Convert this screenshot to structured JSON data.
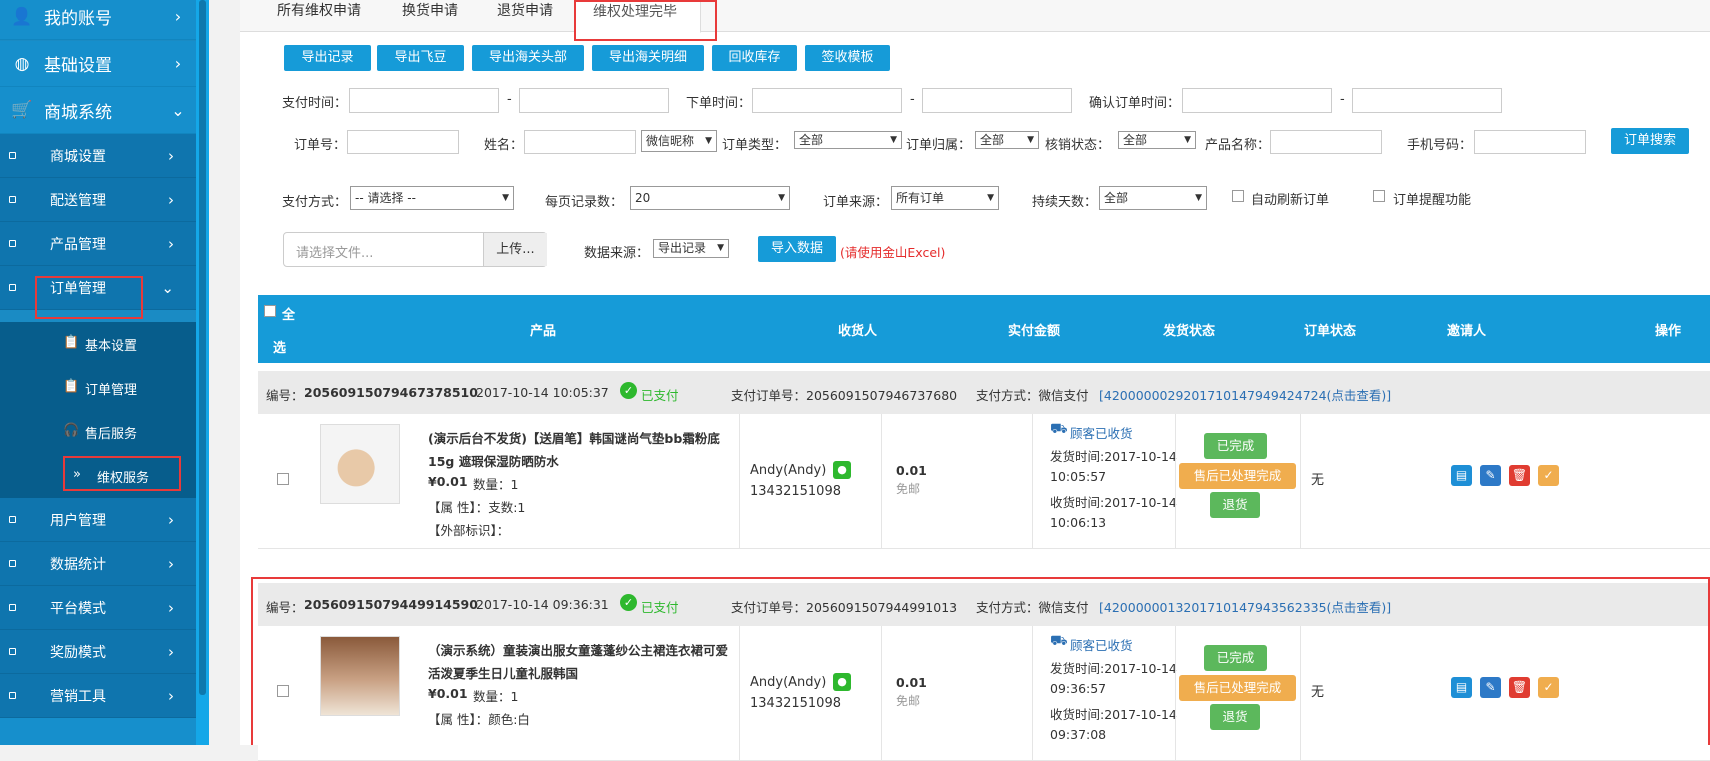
{
  "sidebar": {
    "top_items": [
      {
        "label": "我的账号",
        "icon": "user-icon"
      },
      {
        "label": "基础设置",
        "icon": "globe-icon"
      },
      {
        "label": "商城系统",
        "icon": "cart-icon"
      }
    ],
    "sub_items": [
      "商城设置",
      "配送管理",
      "产品管理",
      "订单管理"
    ],
    "leaf_items": [
      "基本设置",
      "订单管理",
      "售后服务",
      "维权服务"
    ],
    "bottom_items": [
      "用户管理",
      "数据统计",
      "平台模式",
      "奖励模式",
      "营销工具"
    ]
  },
  "tabs": [
    "所有维权申请",
    "换货申请",
    "退货申请",
    "维权处理完毕"
  ],
  "toolbar": [
    "导出记录",
    "导出飞豆",
    "导出海关头部",
    "导出海关明细",
    "回收库存",
    "签收模板"
  ],
  "filters": {
    "pay_time": "支付时间：",
    "order_time": "下单时间：",
    "confirm_time": "确认订单时间：",
    "dash": "-",
    "order_no": "订单号：",
    "name": "姓名：",
    "nick_select": "微信昵称",
    "order_type": "订单类型：",
    "order_type_val": "全部",
    "order_belong": "订单归属：",
    "order_belong_val": "全部",
    "verify_status": "核销状态：",
    "verify_status_val": "全部",
    "product_name": "产品名称：",
    "phone": "手机号码：",
    "search_btn": "订单搜索",
    "pay_method": "支付方式：",
    "pay_method_val": "-- 请选择 --",
    "per_page": "每页记录数：",
    "per_page_val": "20",
    "order_source": "订单来源：",
    "order_source_val": "所有订单",
    "duration": "持续天数：",
    "duration_val": "全部",
    "auto_refresh": "自动刷新订单",
    "order_remind": "订单提醒功能"
  },
  "import": {
    "file_placeholder": "请选择文件...",
    "upload_btn": "上传...",
    "source_label": "数据来源：",
    "source_val": "导出记录",
    "import_btn": "导入数据",
    "hint": "(请使用金山Excel)"
  },
  "table_header": {
    "select_all_1": "全",
    "select_all_2": "选",
    "product": "产品",
    "receiver": "收货人",
    "paid": "实付金额",
    "ship_status": "发货状态",
    "order_status": "订单状态",
    "inviter": "邀请人",
    "ops": "操作"
  },
  "orders": [
    {
      "no_label": "编号：",
      "no": "20560915079467378510",
      "time": "2017-10-14 10:05:37",
      "paid_status": "已支付",
      "pay_order_no": "支付订单号：2056091507946737680",
      "pay_method": "支付方式：微信支付",
      "txn": "[4200000029201710147949424724(点击查看)]",
      "title_1": "(演示后台不发货)【送眉笔】韩国谜尚气垫bb霜粉底",
      "title_2": "15g 遮瑕保湿防晒防水",
      "price": "¥0.01",
      "qty": "数量：1",
      "attr": "【属 性】：支数:1",
      "ext": "【外部标识】：",
      "receiver": "Andy(Andy)",
      "phone": "13432151098",
      "amount": "0.01",
      "shipping": "免邮",
      "ship_status": "顾客已收货",
      "ship_time_1": "发货时间:2017-10-14",
      "ship_time_2": "10:05:57",
      "recv_time_1": "收货时间:2017-10-14",
      "recv_time_2": "10:06:13",
      "status_done": "已完成",
      "status_after": "售后已处理完成",
      "status_refund": "退货",
      "inviter": "无"
    },
    {
      "no_label": "编号：",
      "no": "20560915079449914590",
      "time": "2017-10-14 09:36:31",
      "paid_status": "已支付",
      "pay_order_no": "支付订单号：2056091507944991013",
      "pay_method": "支付方式：微信支付",
      "txn": "[4200000013201710147943562335(点击查看)]",
      "title_1": "（演示系统）童装演出服女童蓬蓬纱公主裙连衣裙可爱",
      "title_2": "活泼夏季生日儿童礼服韩国",
      "price": "¥0.01",
      "qty": "数量：1",
      "attr": "【属 性】：颜色:白",
      "ext": "",
      "receiver": "Andy(Andy)",
      "phone": "13432151098",
      "amount": "0.01",
      "shipping": "免邮",
      "ship_status": "顾客已收货",
      "ship_time_1": "发货时间:2017-10-14",
      "ship_time_2": "09:36:57",
      "recv_time_1": "收货时间:2017-10-14",
      "recv_time_2": "09:37:08",
      "status_done": "已完成",
      "status_after": "售后已处理完成",
      "status_refund": "退货",
      "inviter": "无"
    }
  ]
}
